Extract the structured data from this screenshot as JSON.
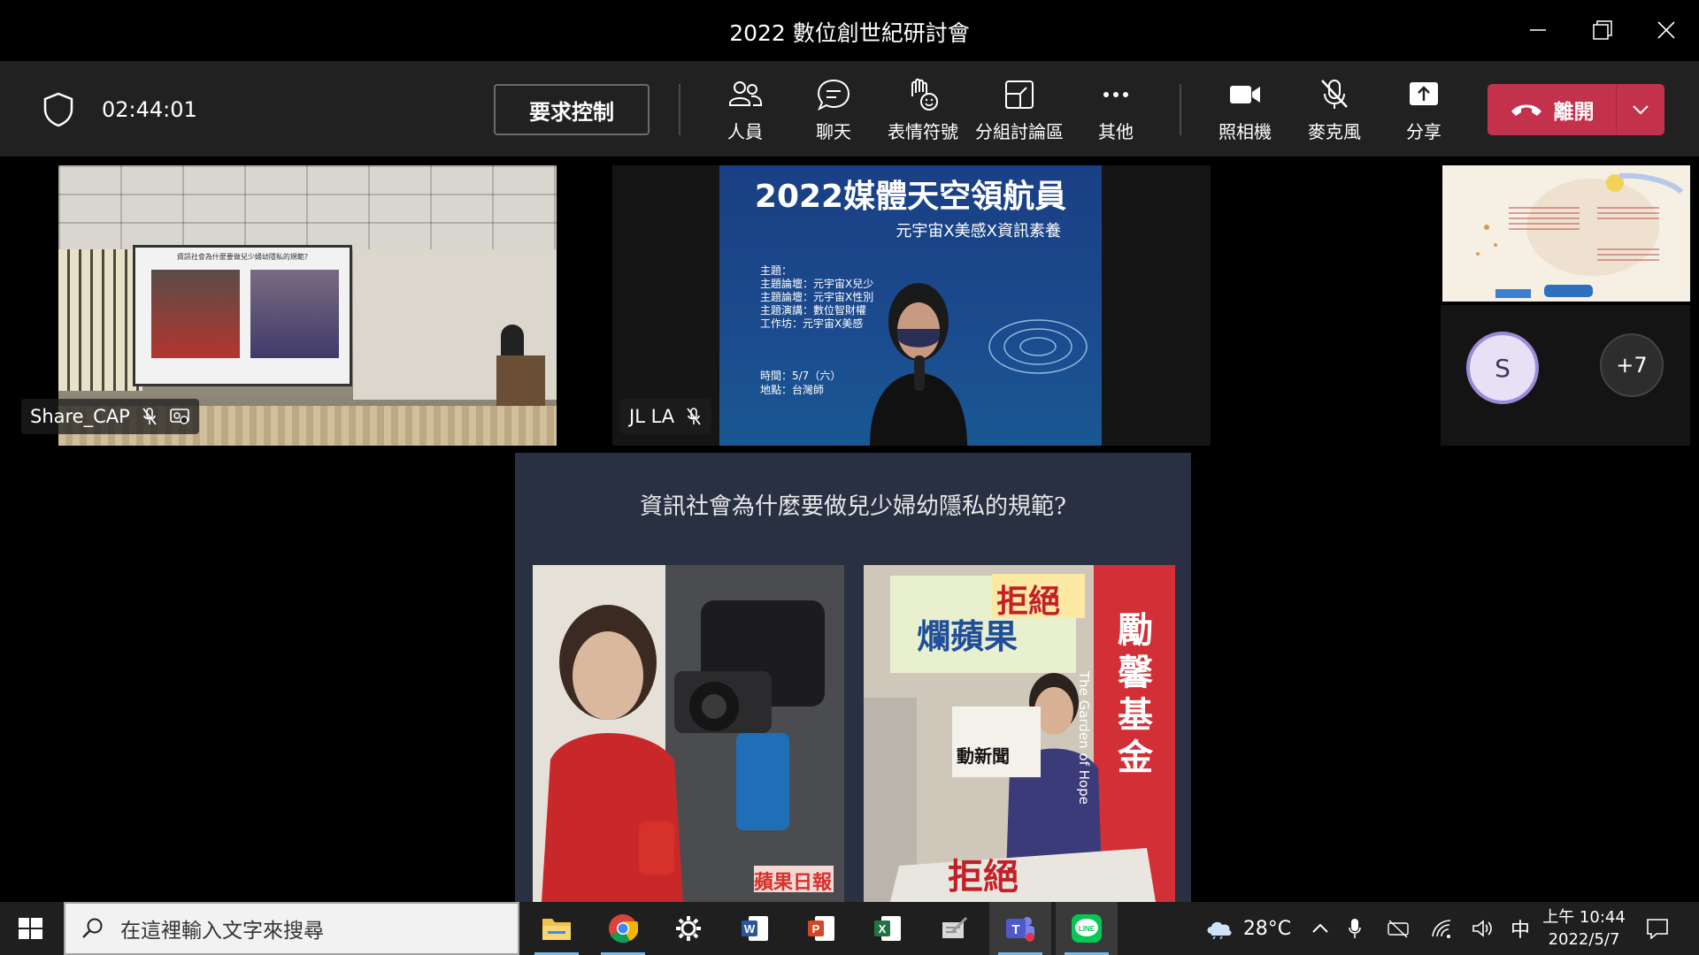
{
  "window": {
    "title": "2022 數位創世紀研討會"
  },
  "toolbar": {
    "timer": "02:44:01",
    "request_control": "要求控制",
    "people": "人員",
    "chat": "聊天",
    "reactions": "表情符號",
    "rooms": "分組討論區",
    "more": "其他",
    "camera": "照相機",
    "mic": "麥克風",
    "share": "分享",
    "leave": "離開"
  },
  "tiles": {
    "share_cap": {
      "name": "Share_CAP",
      "screen_text": "資訊社會為什麼要做兒少婦幼隱私的規範?"
    },
    "jl_la": {
      "name": "JL LA",
      "slide_title": "2022媒體天空領航員",
      "slide_subtitle": "元宇宙X美感X資訊素養",
      "slide_lines": [
        "主題：",
        "主題論壇：元宇宙X兒少",
        "主題論壇：元宇宙X性別",
        "主題演講：數位智財權",
        "工作坊：元宇宙X美感"
      ],
      "slide_time": "時間：5/7（六）",
      "slide_place": "地點：台灣師"
    },
    "participant_initial": "S",
    "overflow_count": "+7"
  },
  "shared_content": {
    "question": "資訊社會為什麼要做兒少婦幼隱私的規範?",
    "photo1_logo": "蘋果日報",
    "photo2_sign_top": "拒絕",
    "photo2_sign_mid": "爛蘋果",
    "photo2_sign_bottom": "動新聞",
    "photo2_side": "The Garden of Hope",
    "photo2_big": "勵馨基金",
    "photo2_placard": "拒絕"
  },
  "taskbar": {
    "search_placeholder": "在這裡輸入文字來搜尋",
    "weather": "28°C",
    "ime": "中",
    "time": "上午 10:44",
    "date": "2022/5/7"
  },
  "colors": {
    "leave_red": "#c4314b",
    "toolbar_bg": "#212121",
    "slide_blue": "#1b4b8e",
    "avatar_ring": "#9b8ad9"
  }
}
